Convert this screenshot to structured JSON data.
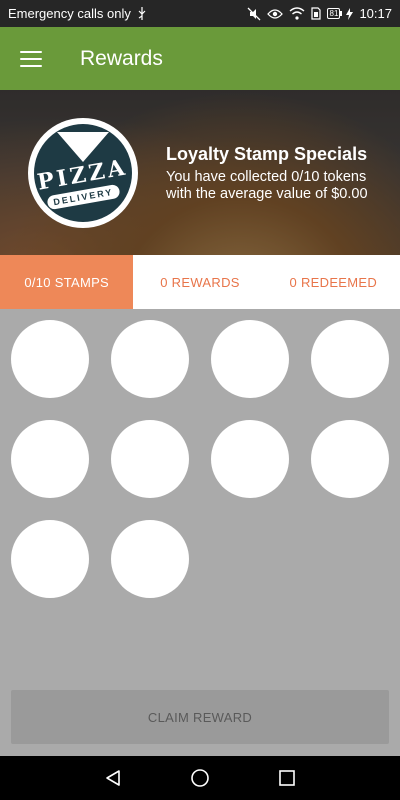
{
  "status_bar": {
    "carrier_text": "Emergency calls only",
    "battery_level": "81",
    "time": "10:17",
    "icons": [
      "usb-icon",
      "mute-icon",
      "eye-icon",
      "wifi-icon",
      "sim-icon",
      "battery-icon",
      "charging-icon"
    ]
  },
  "app_bar": {
    "title": "Rewards",
    "menu_icon": "hamburger-menu-icon",
    "color": "#6a9a3a"
  },
  "banner": {
    "logo_word_top": "PIZZA",
    "logo_word_bottom": "DELIVERY",
    "title": "Loyalty Stamp Specials",
    "line1": "You have collected 0/10 tokens",
    "line2": "with the average value of $0.00"
  },
  "tabs": [
    {
      "label": "0/10 STAMPS",
      "active": true
    },
    {
      "label": "0 REWARDS",
      "active": false
    },
    {
      "label": "0 REDEEMED",
      "active": false
    }
  ],
  "tab_active_color": "#ee8858",
  "tab_text_color": "#e8754a",
  "stamps": {
    "total": 10,
    "collected": 0
  },
  "claim_button": {
    "label": "CLAIM REWARD",
    "enabled": false
  },
  "nav_bar": {
    "icons": [
      "back-icon",
      "home-icon",
      "recents-icon"
    ]
  }
}
